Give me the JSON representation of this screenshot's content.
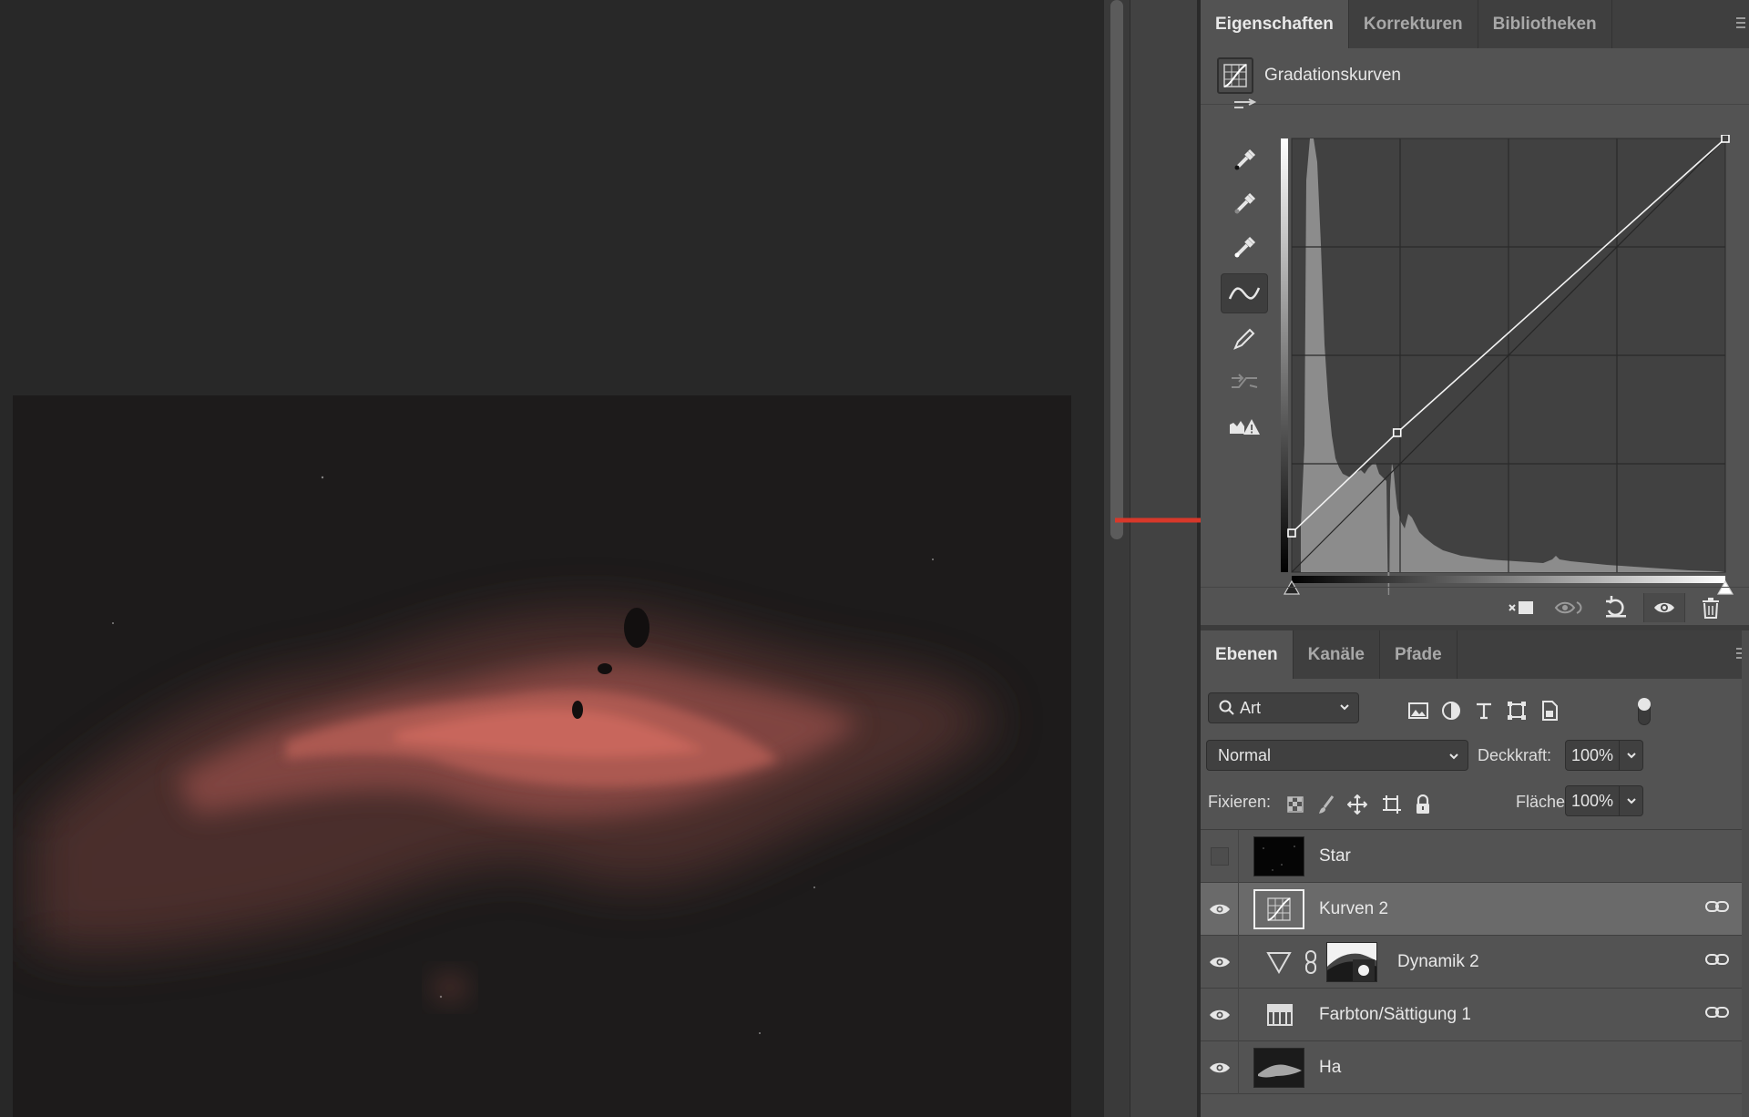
{
  "properties_panel": {
    "tabs": [
      {
        "label": "Eigenschaften",
        "active": true
      },
      {
        "label": "Korrekturen",
        "active": false
      },
      {
        "label": "Bibliotheken",
        "active": false
      }
    ],
    "adjustment_title": "Gradationskurven",
    "curve_points": [
      {
        "input": 0,
        "output": 23
      },
      {
        "input": 62,
        "output": 82
      },
      {
        "input": 255,
        "output": 255
      }
    ]
  },
  "layers_panel": {
    "tabs": [
      {
        "label": "Ebenen",
        "active": true
      },
      {
        "label": "Kanäle",
        "active": false
      },
      {
        "label": "Pfade",
        "active": false
      }
    ],
    "filter_label": "Art",
    "blend_mode": "Normal",
    "opacity_label": "Deckkraft:",
    "opacity_value": "100%",
    "lock_label": "Fixieren:",
    "fill_label": "Fläche:",
    "fill_value": "100%",
    "layers": [
      {
        "name": "Star",
        "visible": false,
        "selected": false
      },
      {
        "name": "Kurven 2",
        "visible": true,
        "selected": true
      },
      {
        "name": "Dynamik 2",
        "visible": true,
        "selected": false
      },
      {
        "name": "Farbton/Sättigung 1",
        "visible": true,
        "selected": false
      },
      {
        "name": "Ha",
        "visible": true,
        "selected": false
      }
    ]
  },
  "colors": {
    "annotation_arrow": "#d8382a",
    "nebula": "#c96559"
  }
}
